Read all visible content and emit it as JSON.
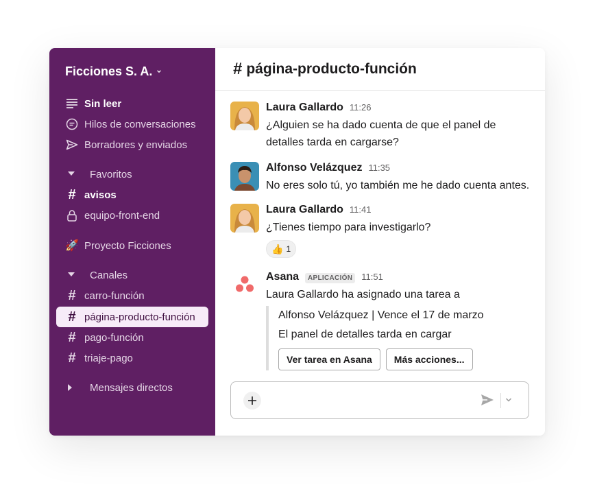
{
  "workspace": {
    "name": "Ficciones S. A."
  },
  "sidebar": {
    "nav": [
      {
        "label": "Sin leer",
        "icon": "unread-list-icon"
      },
      {
        "label": "Hilos de conversaciones",
        "icon": "threads-icon"
      },
      {
        "label": "Borradores y enviados",
        "icon": "send-drafts-icon"
      }
    ],
    "favorites": {
      "title": "Favoritos",
      "items": [
        {
          "label": "avisos",
          "icon": "hash-icon"
        },
        {
          "label": "equipo-front-end",
          "icon": "lock-icon"
        }
      ]
    },
    "project": {
      "label": "Proyecto Ficciones",
      "icon": "rocket-icon"
    },
    "channels": {
      "title": "Canales",
      "items": [
        {
          "label": "carro-función"
        },
        {
          "label": "página-producto-función",
          "active": true
        },
        {
          "label": "pago-función"
        },
        {
          "label": "triaje-pago"
        }
      ]
    },
    "direct_messages": {
      "title": "Mensajes directos"
    }
  },
  "channel": {
    "hash": "#",
    "name": "página-producto-función"
  },
  "messages": [
    {
      "author": "Laura Gallardo",
      "time": "11:26",
      "lines": [
        "¿Alguien se ha dado cuenta de que el panel de",
        "detalles tarda en cargarse?"
      ]
    },
    {
      "author": "Alfonso Velázquez",
      "time": "11:35",
      "lines": [
        "No eres solo tú, yo también me he dado cuenta antes."
      ]
    },
    {
      "author": "Laura Gallardo",
      "time": "11:41",
      "lines": [
        "¿Tienes tiempo para investigarlo?"
      ],
      "reaction": {
        "emoji": "👍",
        "count": "1"
      }
    },
    {
      "author": "Asana",
      "badge": "APLICACIÓN",
      "time": "11:51",
      "lines": [
        "Laura Gallardo ha asignado una tarea a"
      ],
      "attachment": {
        "line1": "Alfonso Velázquez | Vence el 17 de marzo",
        "line2": "El panel de detalles tarda en cargar",
        "button1": "Ver tarea en Asana",
        "button2": "Más acciones..."
      }
    }
  ],
  "colors": {
    "sidebar": "#5f1f63",
    "active_item": "#f7ebf8",
    "asana": "#f06a6a"
  }
}
